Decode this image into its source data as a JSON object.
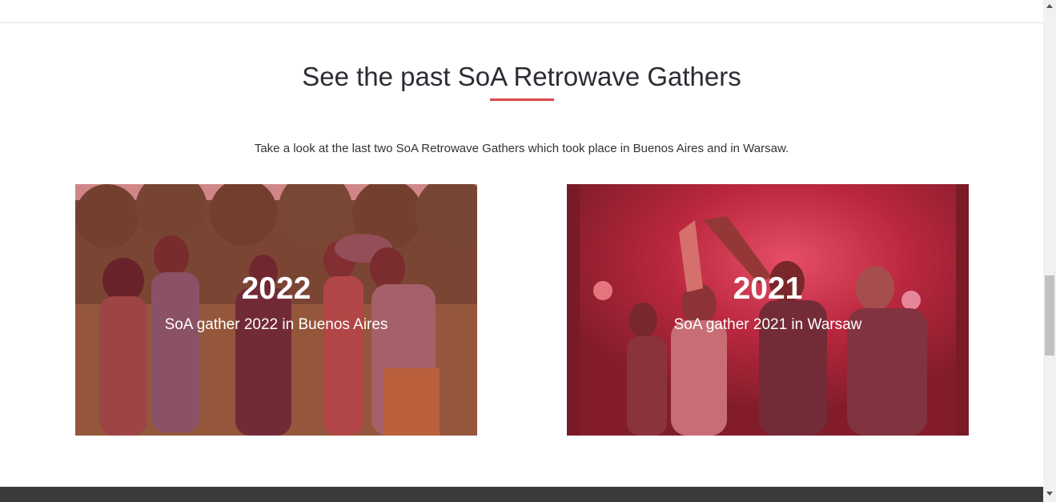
{
  "section": {
    "heading": "See the past SoA Retrowave Gathers",
    "intro": "Take a look at the last two SoA Retrowave Gathers which took place in Buenos Aires and in Warsaw."
  },
  "cards": [
    {
      "year": "2022",
      "caption": "SoA gather 2022 in Buenos Aires",
      "photo": "outdoor-festival-crowd-photo"
    },
    {
      "year": "2021",
      "caption": "SoA gather 2021 in Warsaw",
      "photo": "nightclub-dancing-photo"
    }
  ],
  "colors": {
    "accent": "#e0484a",
    "overlay": "#c82c40",
    "footer": "#3a3a3d",
    "heading_text": "#2c2c34"
  }
}
